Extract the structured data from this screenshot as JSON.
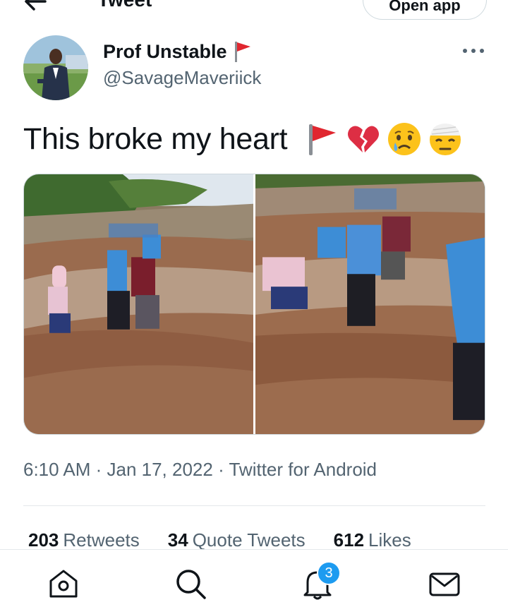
{
  "header": {
    "title": "Tweet",
    "open_app_label": "Open app",
    "back_icon": "arrow-left-icon"
  },
  "tweet": {
    "author_name": "Prof Unstable",
    "author_handle": "@SavageMaveriick",
    "text": "This broke my heart",
    "emojis": [
      "red-flag",
      "broken-heart",
      "crying-face",
      "face-with-head-bandage"
    ],
    "timestamp": "6:10 AM · Jan 17, 2022 · Twitter for Android"
  },
  "stats": [
    {
      "count": "203",
      "label": "Retweets"
    },
    {
      "count": "34",
      "label": "Quote Tweets"
    },
    {
      "count": "612",
      "label": "Likes"
    }
  ],
  "bottom_nav": {
    "items": [
      "home-icon",
      "search-icon",
      "notifications-icon",
      "messages-icon"
    ],
    "notification_badge": "3"
  },
  "colors": {
    "text_primary": "#0f1419",
    "text_secondary": "#536471",
    "accent": "#1d9bf0",
    "divider": "#e4e8eb"
  }
}
